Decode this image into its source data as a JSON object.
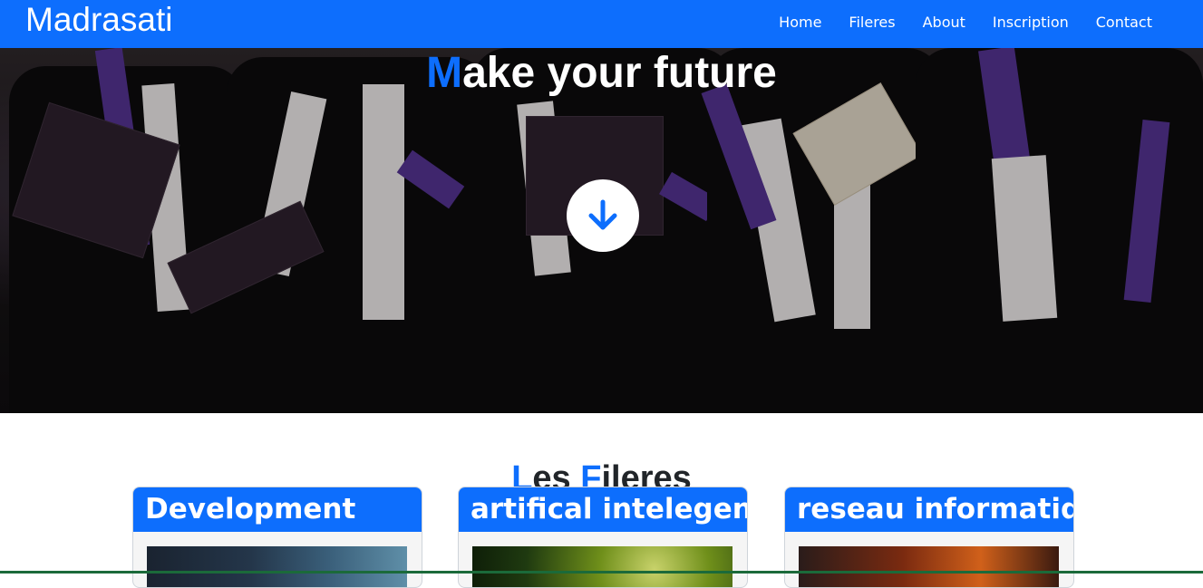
{
  "brand": "Madrasati",
  "nav": {
    "items": [
      {
        "label": "Home"
      },
      {
        "label": "Fileres"
      },
      {
        "label": "About"
      },
      {
        "label": "Inscription"
      },
      {
        "label": "Contact"
      }
    ]
  },
  "hero": {
    "title_first": "M",
    "title_rest": "ake your future",
    "button_icon": "arrow-down-icon"
  },
  "section": {
    "title_l": "L",
    "title_1": "es ",
    "title_f": "F",
    "title_2": "ileres"
  },
  "cards": [
    {
      "title": "Development"
    },
    {
      "title": "artifical intelegent"
    },
    {
      "title": "reseau informatique"
    }
  ],
  "colors": {
    "primary": "#0d6efd",
    "text": "#212529",
    "white": "#ffffff"
  }
}
